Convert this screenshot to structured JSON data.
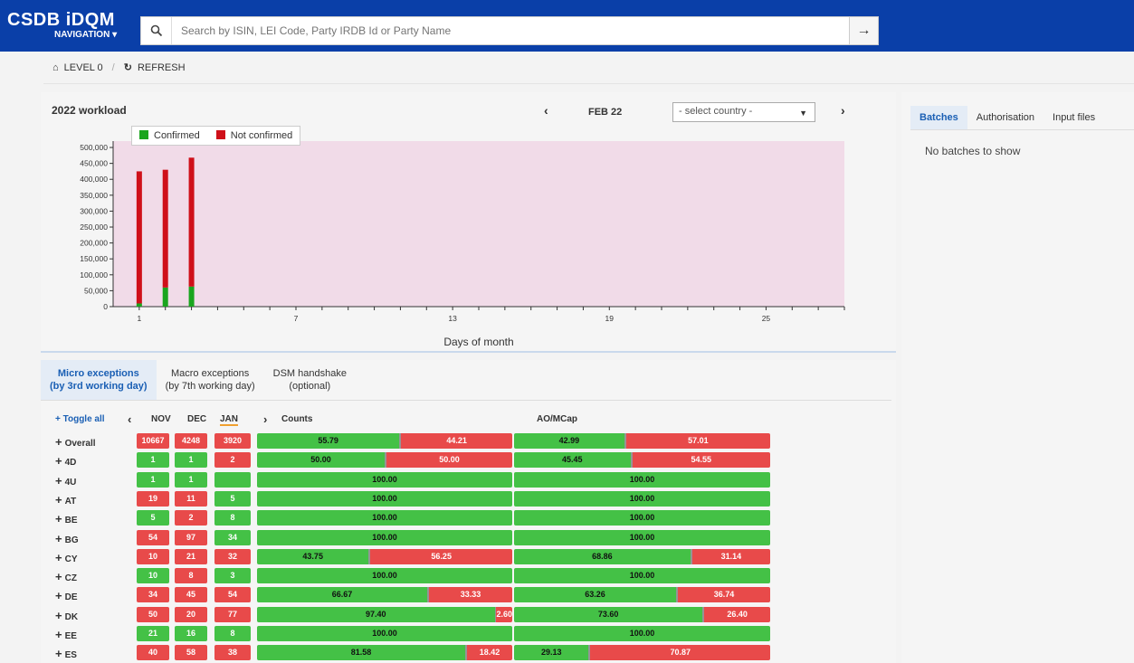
{
  "header": {
    "brand": "CSDB iDQM",
    "nav_label": "NAVIGATION ▾",
    "search_placeholder": "Search by ISIN, LEI Code, Party IRDB Id or Party Name"
  },
  "breadcrumb": {
    "level": "LEVEL 0",
    "refresh": "REFRESH"
  },
  "workload": {
    "title": "2022 workload",
    "month": "FEB 22",
    "country_placeholder": "- select country -",
    "colors": {
      "confirmed": "#1aa51e",
      "not_confirmed": "#cf1019",
      "plot_bg": "#f1dbe8"
    }
  },
  "chart_data": {
    "type": "bar",
    "stacked": true,
    "x": [
      1,
      2,
      3
    ],
    "series": [
      {
        "name": "Confirmed",
        "values": [
          10000,
          60000,
          63000
        ]
      },
      {
        "name": "Not confirmed",
        "values": [
          415000,
          370000,
          405000
        ]
      }
    ],
    "xlabel": "Days of month",
    "ylabel": "",
    "ylim": [
      0,
      520000
    ],
    "xlim": [
      0,
      28
    ],
    "yticks": [
      0,
      50000,
      100000,
      150000,
      200000,
      250000,
      300000,
      350000,
      400000,
      450000,
      500000
    ],
    "ytick_labels": [
      "0",
      "50,000",
      "100,000",
      "150,000",
      "200,000",
      "250,000",
      "300,000",
      "350,000",
      "400,000",
      "450,000",
      "500,000"
    ],
    "xtick_labels": [
      "1",
      "7",
      "13",
      "19",
      "25"
    ],
    "xtick_values": [
      1,
      7,
      13,
      19,
      25
    ],
    "legend": "top-left"
  },
  "right_panel": {
    "tabs": [
      "Batches",
      "Authorisation",
      "Input files"
    ],
    "active_tab": "Batches",
    "message": "No batches to show"
  },
  "exceptions": {
    "tabs": [
      {
        "line1": "Micro exceptions",
        "line2": "(by 3rd working day)"
      },
      {
        "line1": "Macro exceptions",
        "line2": "(by 7th working day)"
      },
      {
        "line1": "DSM handshake",
        "line2": "(optional)"
      }
    ],
    "toggle_all": "+ Toggle all",
    "months": [
      "NOV",
      "DEC",
      "JAN"
    ],
    "counts_header": "Counts",
    "aomcap_header": "AO/MCap",
    "colors": {
      "green": "#44c146",
      "red": "#e84a4a"
    },
    "rows": [
      {
        "name": "Overall",
        "m": [
          {
            "v": "10667",
            "c": "r"
          },
          {
            "v": "4248",
            "c": "r"
          },
          {
            "v": "3920",
            "c": "r"
          }
        ],
        "counts": [
          "55.79",
          "44.21"
        ],
        "aom": [
          "42.99",
          "57.01"
        ]
      },
      {
        "name": "4D",
        "m": [
          {
            "v": "1",
            "c": "g"
          },
          {
            "v": "1",
            "c": "g"
          },
          {
            "v": "2",
            "c": "r"
          }
        ],
        "counts": [
          "50.00",
          "50.00"
        ],
        "aom": [
          "45.45",
          "54.55"
        ]
      },
      {
        "name": "4U",
        "m": [
          {
            "v": "1",
            "c": "g"
          },
          {
            "v": "1",
            "c": "g"
          },
          {
            "v": "",
            "c": "g"
          }
        ],
        "counts": [
          "100.00",
          ""
        ],
        "aom": [
          "100.00",
          ""
        ]
      },
      {
        "name": "AT",
        "m": [
          {
            "v": "19",
            "c": "r"
          },
          {
            "v": "11",
            "c": "r"
          },
          {
            "v": "5",
            "c": "g"
          }
        ],
        "counts": [
          "100.00",
          ""
        ],
        "aom": [
          "100.00",
          ""
        ]
      },
      {
        "name": "BE",
        "m": [
          {
            "v": "5",
            "c": "g"
          },
          {
            "v": "2",
            "c": "r"
          },
          {
            "v": "8",
            "c": "g"
          }
        ],
        "counts": [
          "100.00",
          ""
        ],
        "aom": [
          "100.00",
          ""
        ]
      },
      {
        "name": "BG",
        "m": [
          {
            "v": "54",
            "c": "r"
          },
          {
            "v": "97",
            "c": "r"
          },
          {
            "v": "34",
            "c": "g"
          }
        ],
        "counts": [
          "100.00",
          ""
        ],
        "aom": [
          "100.00",
          ""
        ]
      },
      {
        "name": "CY",
        "m": [
          {
            "v": "10",
            "c": "r"
          },
          {
            "v": "21",
            "c": "r"
          },
          {
            "v": "32",
            "c": "r"
          }
        ],
        "counts": [
          "43.75",
          "56.25"
        ],
        "aom": [
          "68.86",
          "31.14"
        ]
      },
      {
        "name": "CZ",
        "m": [
          {
            "v": "10",
            "c": "g"
          },
          {
            "v": "8",
            "c": "r"
          },
          {
            "v": "3",
            "c": "g"
          }
        ],
        "counts": [
          "100.00",
          ""
        ],
        "aom": [
          "100.00",
          ""
        ]
      },
      {
        "name": "DE",
        "m": [
          {
            "v": "34",
            "c": "r"
          },
          {
            "v": "45",
            "c": "r"
          },
          {
            "v": "54",
            "c": "r"
          }
        ],
        "counts": [
          "66.67",
          "33.33"
        ],
        "aom": [
          "63.26",
          "36.74"
        ]
      },
      {
        "name": "DK",
        "m": [
          {
            "v": "50",
            "c": "r"
          },
          {
            "v": "20",
            "c": "r"
          },
          {
            "v": "77",
            "c": "r"
          }
        ],
        "counts": [
          "97.40",
          "2.60"
        ],
        "aom": [
          "73.60",
          "26.40"
        ]
      },
      {
        "name": "EE",
        "m": [
          {
            "v": "21",
            "c": "g"
          },
          {
            "v": "16",
            "c": "g"
          },
          {
            "v": "8",
            "c": "g"
          }
        ],
        "counts": [
          "100.00",
          ""
        ],
        "aom": [
          "100.00",
          ""
        ]
      },
      {
        "name": "ES",
        "m": [
          {
            "v": "40",
            "c": "r"
          },
          {
            "v": "58",
            "c": "r"
          },
          {
            "v": "38",
            "c": "r"
          }
        ],
        "counts": [
          "81.58",
          "18.42"
        ],
        "aom": [
          "29.13",
          "70.87"
        ]
      }
    ]
  }
}
